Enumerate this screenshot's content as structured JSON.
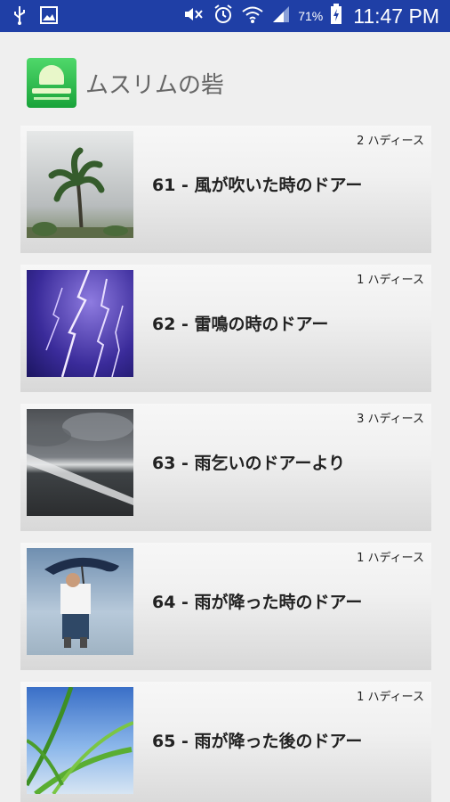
{
  "status_bar": {
    "battery_percent": "71%",
    "time": "11:47 PM",
    "icons": [
      "usb-icon",
      "image-icon",
      "mute-icon",
      "alarm-icon",
      "wifi-icon",
      "signal-icon",
      "battery-charging-icon"
    ]
  },
  "header": {
    "title": "ムスリムの砦"
  },
  "items": [
    {
      "title": "61 - 風が吹いた時のドアー",
      "count": "2 ハディース",
      "thumb": "palm-tree-wind"
    },
    {
      "title": "62 - 雷鳴の時のドアー",
      "count": "1 ハディース",
      "thumb": "lightning"
    },
    {
      "title": "63 - 雨乞いのドアーより",
      "count": "3 ハディース",
      "thumb": "storm-clouds"
    },
    {
      "title": "64 - 雨が降った時のドアー",
      "count": "1 ハディース",
      "thumb": "child-umbrella-rain"
    },
    {
      "title": "65 - 雨が降った後のドアー",
      "count": "1 ハディース",
      "thumb": "wet-leaves"
    }
  ]
}
